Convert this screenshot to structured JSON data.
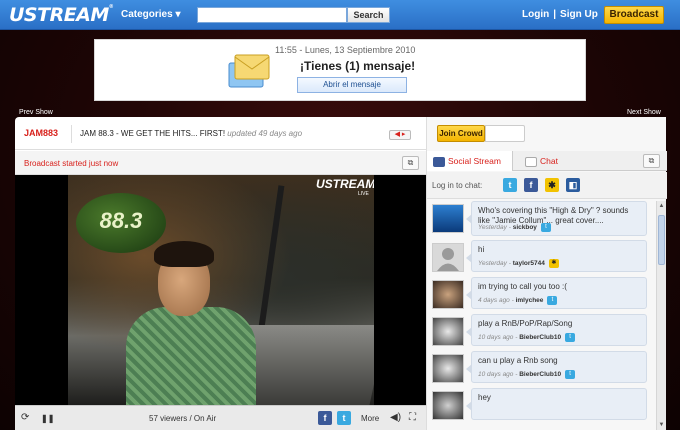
{
  "nav": {
    "logo": "USTREAM",
    "logo_mark": "®",
    "categories_label": "Categories ▾",
    "search_placeholder": "",
    "search_button": "Search",
    "login": "Login",
    "separator": "|",
    "signup": "Sign Up",
    "broadcast": "Broadcast"
  },
  "ad": {
    "time": "11:55 - Lunes, 13 Septiembre 2010",
    "headline": "¡Tienes (1) mensaje!",
    "button": "Abrir el mensaje"
  },
  "show_nav": {
    "prev": "Prev Show",
    "next": "Next Show"
  },
  "player": {
    "channel": "JAM883",
    "title": "JAM 88.3 - WE GET THE HITS... FIRST!",
    "updated": "updated 49 days ago",
    "status": "Broadcast started just now",
    "viewers": "57 viewers / On Air",
    "more": "More",
    "watermark": "USTREAM",
    "watermark_live": "LIVE",
    "sign_text": "88.3"
  },
  "social": {
    "join_crowd": "Join Crowd",
    "tab_social": "Social Stream",
    "tab_chat": "Chat",
    "login_label": "Log in to chat:",
    "messages": [
      {
        "text": "Who's covering this \"High & Dry\" ? sounds like \"Jamie Collum\"... great cover....",
        "when": "Yesterday",
        "user": "sickboy",
        "source": "twitter"
      },
      {
        "text": "hi",
        "when": "Yesterday",
        "user": "taylor5744",
        "source": "aim"
      },
      {
        "text": "im trying to call you too :(",
        "when": "4 days ago",
        "user": "imlychee",
        "source": "twitter"
      },
      {
        "text": "play a RnB/PoP/Rap/Song",
        "when": "10 days ago",
        "user": "BieberClub10",
        "source": "twitter"
      },
      {
        "text": "can u play a Rnb song",
        "when": "10 days ago",
        "user": "BieberClub10",
        "source": "twitter"
      },
      {
        "text": "hey",
        "when": "",
        "user": "",
        "source": ""
      }
    ]
  },
  "colors": {
    "nav_blue": "#2a6fc6",
    "accent_red": "#d8211c",
    "broadcast_yellow": "#f4b400",
    "bubble_bg": "#e8eef6"
  }
}
